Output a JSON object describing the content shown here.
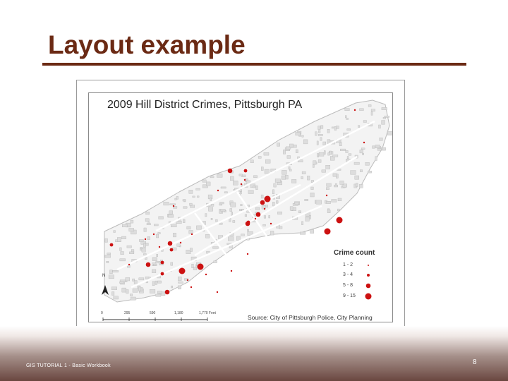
{
  "slide": {
    "title": "Layout example",
    "footer": "GIS TUTORIAL 1 - Basic Workbook",
    "page_number": "8"
  },
  "map": {
    "title": "2009 Hill District Crimes, Pittsburgh PA",
    "legend": {
      "title": "Crime count",
      "items": [
        {
          "label": "1 - 2"
        },
        {
          "label": "3 - 4"
        },
        {
          "label": "5 - 8"
        },
        {
          "label": "9 - 15"
        }
      ]
    },
    "north_arrow_label": "N",
    "scale_bar": [
      "0",
      "295",
      "590",
      "1,180",
      "1,770 Feet"
    ],
    "source": "Source: City of Pittsburgh Police, City Planning"
  },
  "colors": {
    "title": "#6b2a14",
    "crime_dot": "#cc1111",
    "building": "#dddddd",
    "district_fill": "#f2f2f2"
  }
}
